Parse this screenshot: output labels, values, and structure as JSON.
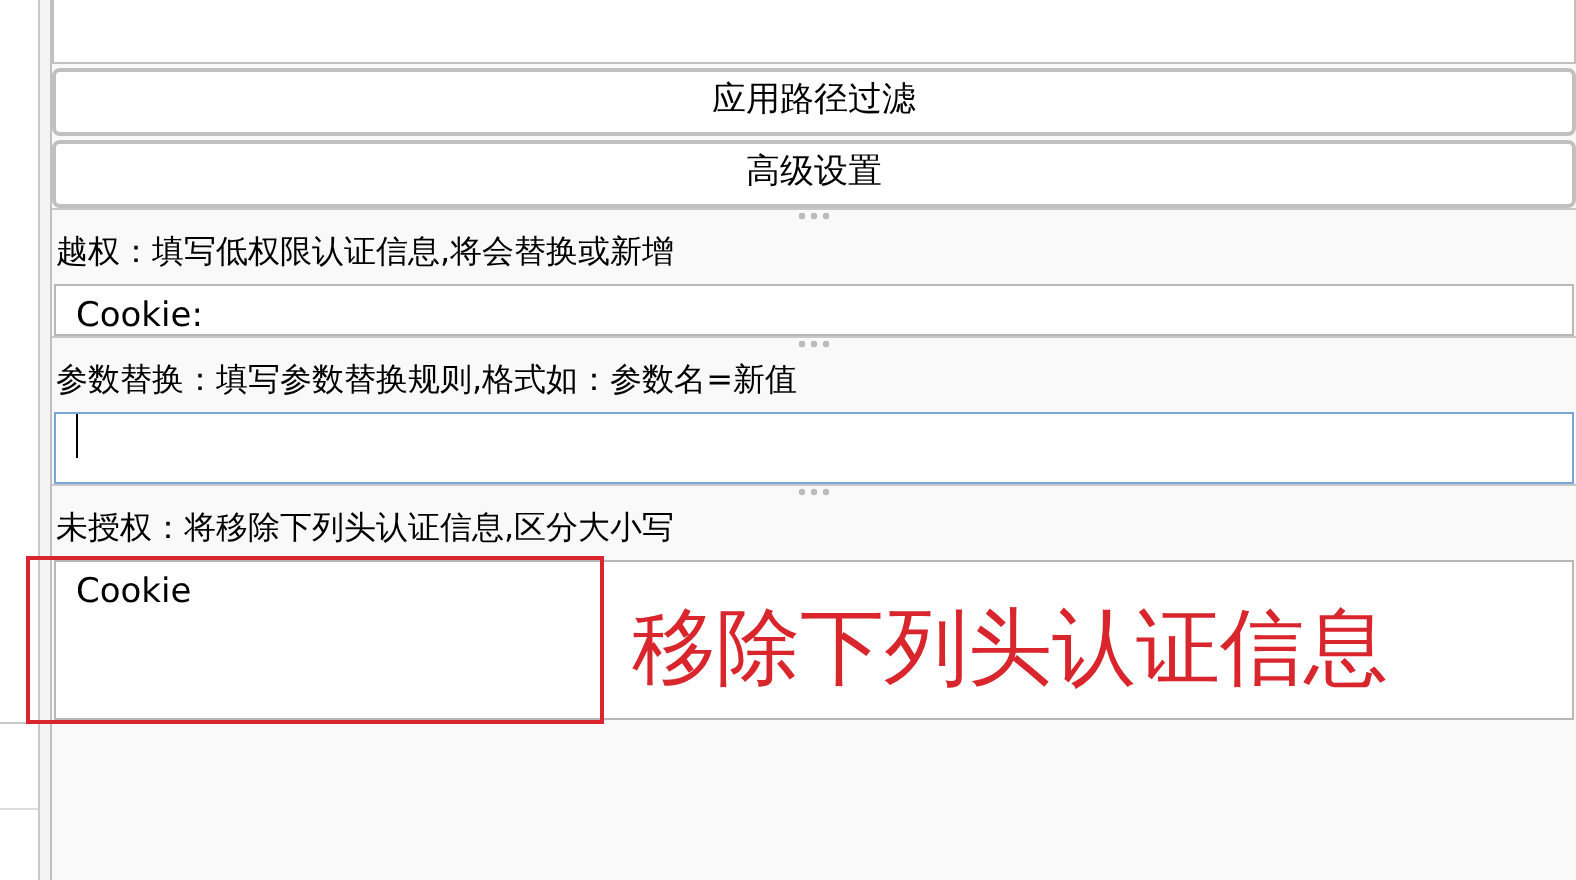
{
  "buttons": [
    "应用路径过滤",
    "高级设置"
  ],
  "sections": [
    {
      "label": "越权：填写低权限认证信息,将会替换或新增",
      "kind": "textarea",
      "value": "Cookie:",
      "focused": false
    },
    {
      "label": "参数替换：填写参数替换规则,格式如：参数名=新值",
      "kind": "input",
      "focused": true
    },
    {
      "label": "未授权：将移除下列头认证信息,区分大小写",
      "kind": "textarea",
      "value": "Cookie",
      "focused": false
    }
  ],
  "annotation": {
    "text": "移除下列头认证信息",
    "color": "#d9262c"
  }
}
